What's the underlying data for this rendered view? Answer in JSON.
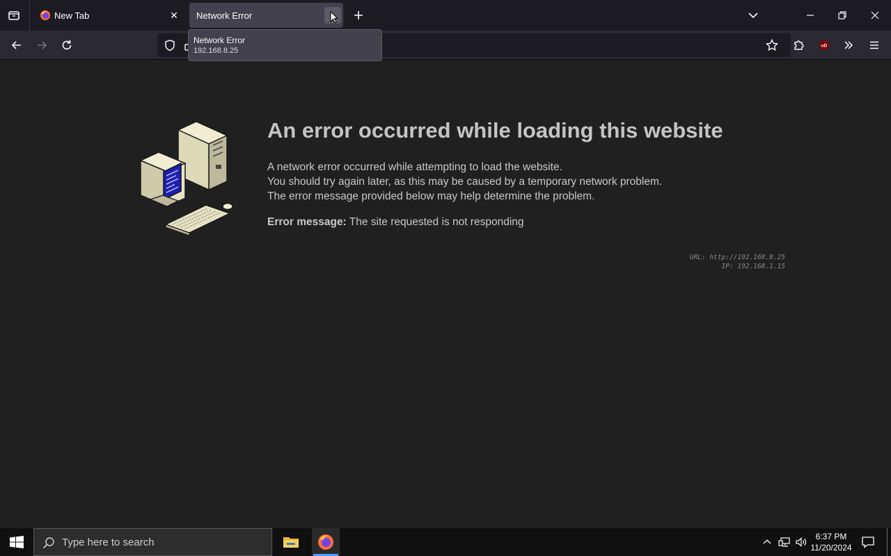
{
  "tabs": [
    {
      "title": "New Tab",
      "icon": "firefox-icon",
      "active": false
    },
    {
      "title": "Network Error",
      "active": true
    }
  ],
  "tooltip": {
    "title": "Network Error",
    "subtitle": "192.168.8.25"
  },
  "error_page": {
    "heading": "An error occurred while loading this website",
    "lines": [
      "A network error occurred while attempting to load the website.",
      "You should try again later, as this may be caused by a temporary network problem.",
      "The error message provided below may help determine the problem."
    ],
    "error_label": "Error message:",
    "error_text": "The site requested is not responding",
    "url_line": "URL: http://192.168.8.25",
    "ip_line": "IP: 192.168.1.15"
  },
  "taskbar": {
    "search_placeholder": "Type here to search",
    "time": "6:37 PM",
    "date": "11/20/2024"
  },
  "colors": {
    "accent": "#4a9eff",
    "content_bg": "#202020",
    "heading": "#c4c4c4",
    "screen_blue": "#1d1fb0"
  }
}
